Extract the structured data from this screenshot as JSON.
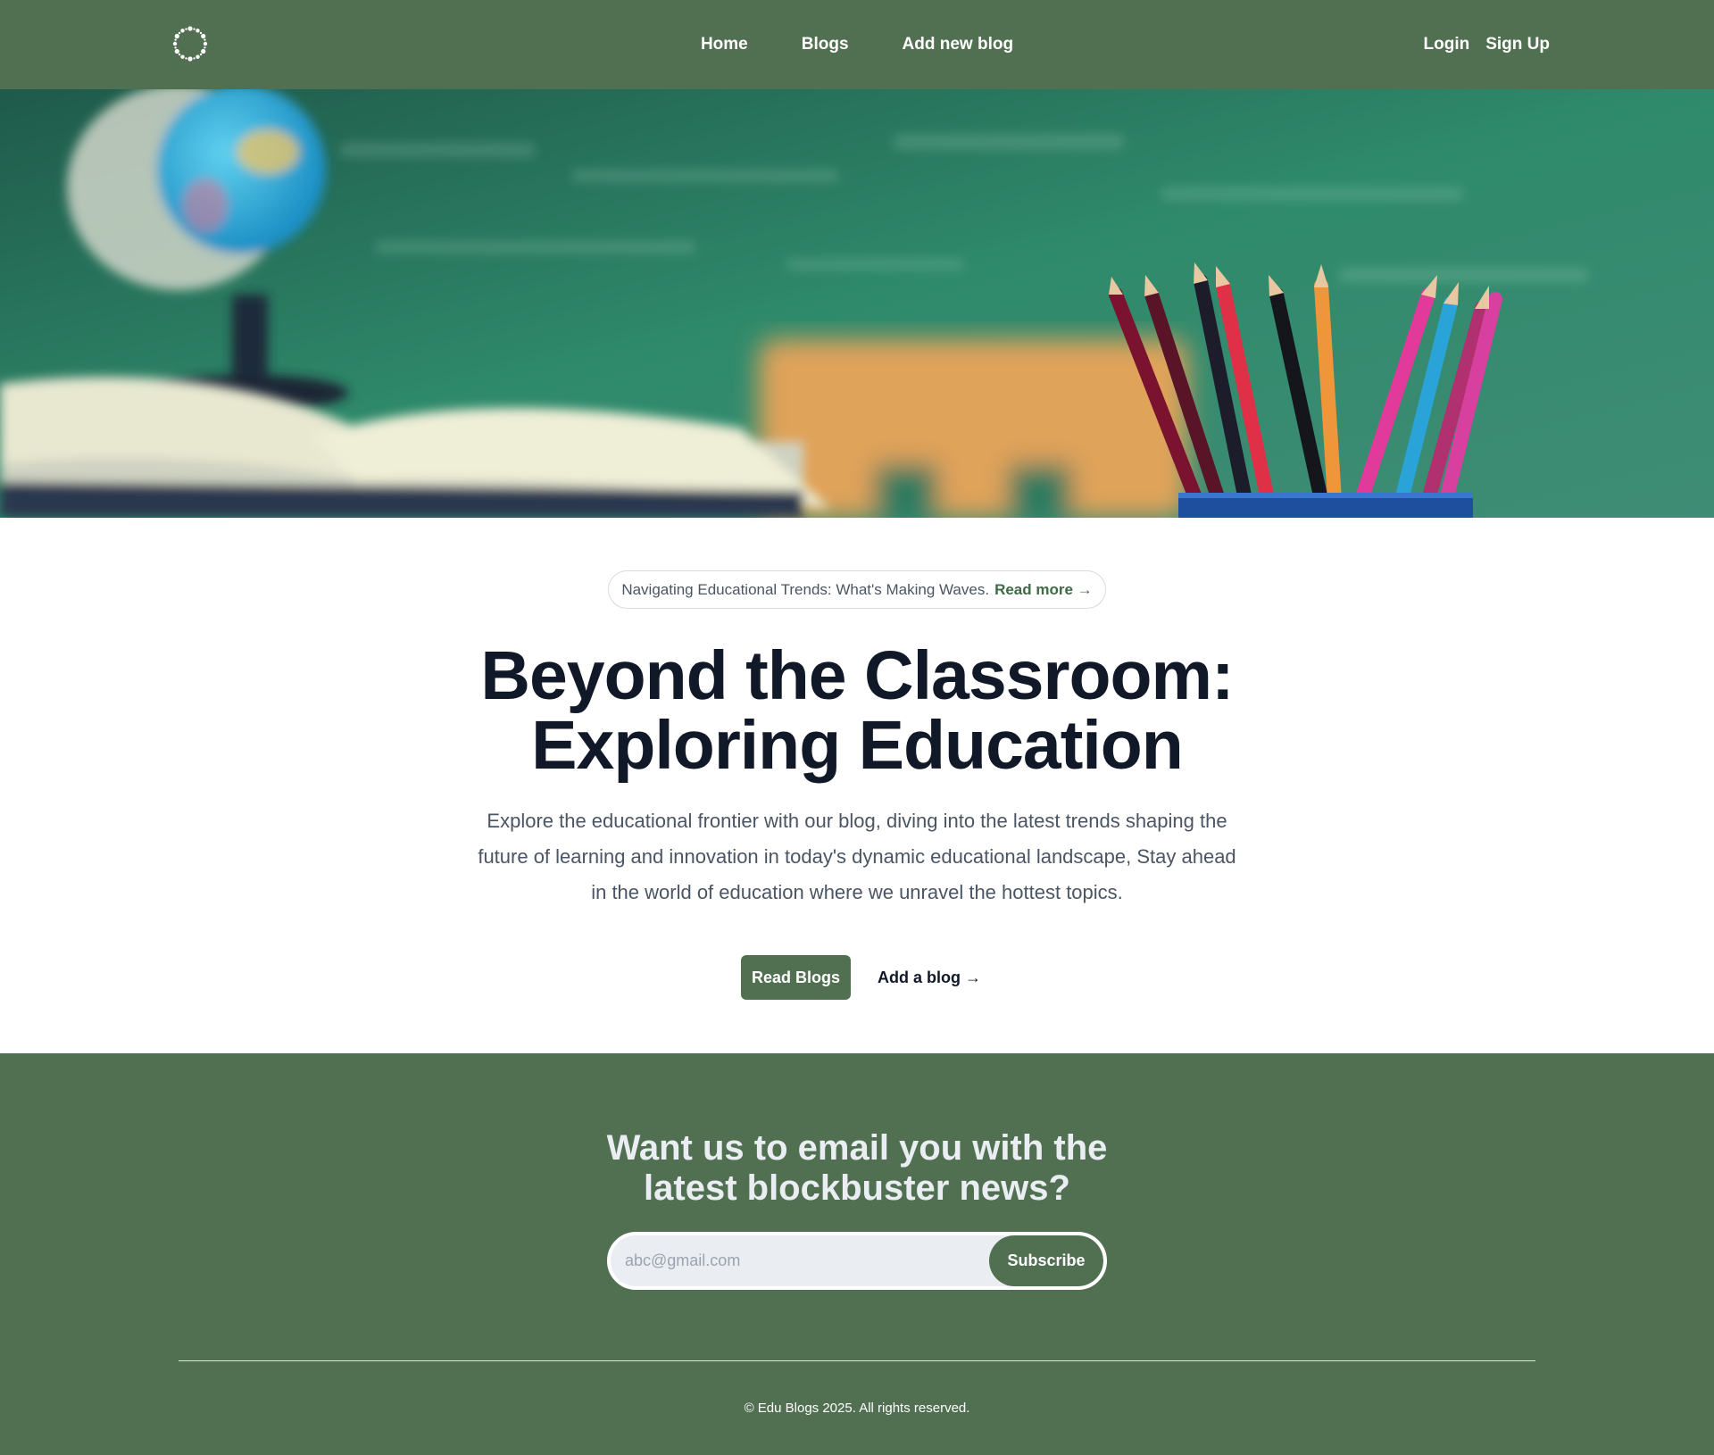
{
  "nav": {
    "logo_icon": "dotted-circle-logo-icon",
    "links": [
      {
        "label": "Home"
      },
      {
        "label": "Blogs"
      },
      {
        "label": "Add new blog"
      }
    ],
    "login_label": "Login",
    "signup_label": "Sign Up"
  },
  "hero": {
    "image_icon": "classroom-photo-with-globe-book-pencils",
    "announcement": {
      "text": "Navigating Educational Trends: What's Making Waves.",
      "link_label": "Read more →"
    },
    "title_line1": "Beyond the Classroom:",
    "title_line2": "Exploring Education",
    "description": "Explore the educational frontier with our blog, diving into the latest trends shaping the future of learning and innovation in today's dynamic educational landscape, Stay ahead in the world of education where we unravel the hottest topics.",
    "primary_button": "Read Blogs",
    "secondary_button": "Add a blog →"
  },
  "newsletter": {
    "title_line1": "Want us to email you with the",
    "title_line2": "latest blockbuster news?",
    "email_placeholder": "abc@gmail.com",
    "subscribe_label": "Subscribe"
  },
  "footer": {
    "copyright": "© Edu Blogs 2025. All rights reserved."
  },
  "colors": {
    "brand_green": "#517052",
    "link_green": "#3f6a47",
    "heading": "#111827",
    "body_text": "#4b5563"
  }
}
